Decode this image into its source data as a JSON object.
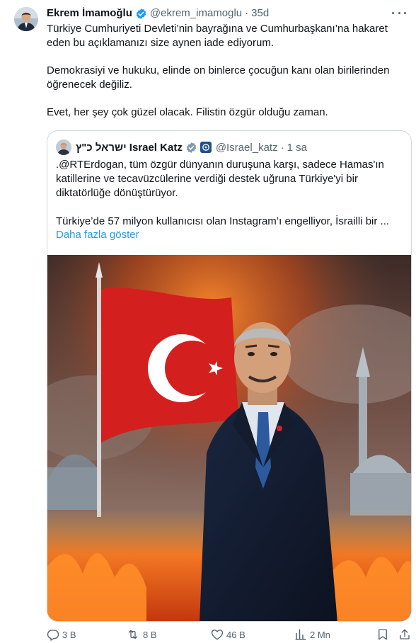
{
  "tweet": {
    "author_name": "Ekrem İmamoğlu",
    "author_handle": "@ekrem_imamoglu",
    "separator": "·",
    "time": "35d",
    "paragraphs": [
      "Türkiye Cumhuriyeti Devleti’nin bayrağına ve Cumhurbaşkanı’na hakaret eden bu açıklamanızı size aynen iade ediyorum.",
      "Demokrasiyi ve hukuku, elinde on binlerce çocuğun kanı olan birilerinden öğrenecek değiliz.",
      "Evet, her şey çok güzel olacak. Filistin özgür olduğu zaman."
    ]
  },
  "quoted": {
    "author_name": "ישראל כ\"ץ Israel Katz",
    "author_handle": "@Israel_katz",
    "separator": "·",
    "time": "1 sa",
    "paragraphs": [
      ".@RTErdogan, tüm özgür dünyanın duruşuna karşı, sadece Hamas'ın katillerine ve tecavüzcülerine verdiği destek uğruna Türkiye'yi bir diktatörlüğe dönüştürüyor.",
      "Türkiye’de 57 milyon kullanıcısı olan Instagram’ı engelliyor, İsrailli bir ..."
    ],
    "show_more": "Daha fazla göster",
    "image_icon": "ai-generated-image"
  },
  "actions": {
    "replies": "3 B",
    "reposts": "8 B",
    "likes": "46 B",
    "views": "2 Mn",
    "reply_icon": "reply-icon",
    "repost_icon": "repost-icon",
    "like_icon": "heart-icon",
    "views_icon": "analytics-icon",
    "bookmark_icon": "bookmark-icon",
    "share_icon": "share-icon"
  },
  "colors": {
    "text": "#0f1419",
    "muted": "#536471",
    "link": "#1d9bf0",
    "verified": "#1d9bf0",
    "border": "#cfd9de"
  }
}
